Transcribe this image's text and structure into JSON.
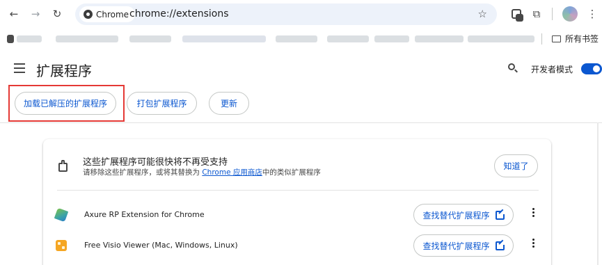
{
  "toolbar": {
    "back_icon": "arrow-left-icon",
    "forward_icon": "arrow-right-icon",
    "reload_icon": "reload-icon",
    "site_chip": "Chrome",
    "url": "chrome://extensions",
    "bookmark_star_icon": "star-icon"
  },
  "bookmarks": {
    "all_bookmarks_label": "所有书签"
  },
  "header": {
    "title": "扩展程序",
    "developer_mode_label": "开发者模式",
    "developer_mode_on": true
  },
  "actions": {
    "load_unpacked": "加载已解压的扩展程序",
    "pack_extension": "打包扩展程序",
    "update": "更新"
  },
  "notice": {
    "title": "这些扩展程序可能很快将不再受支持",
    "subtitle_prefix": "请移除这些扩展程序，或将其替换为 ",
    "subtitle_link": "Chrome 应用商店",
    "subtitle_suffix": "中的类似扩展程序",
    "dismiss": "知道了"
  },
  "extensions": [
    {
      "name": "Axure RP Extension for Chrome",
      "action": "查找替代扩展程序"
    },
    {
      "name": "Free Visio Viewer (Mac, Windows, Linux)",
      "action": "查找替代扩展程序"
    }
  ],
  "colors": {
    "accent": "#0b57d0",
    "highlight_box": "#e53935",
    "omnibox_bg": "#edf2fa"
  }
}
